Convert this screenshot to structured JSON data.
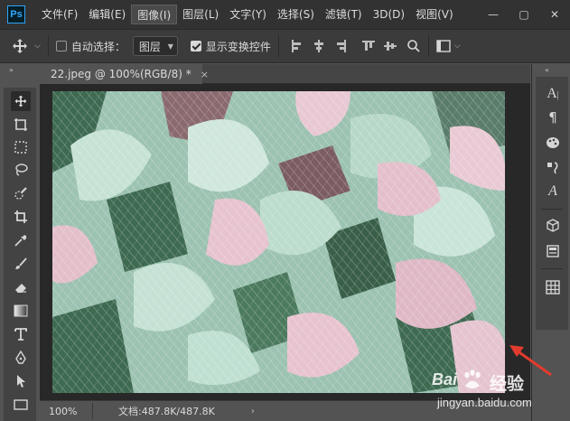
{
  "app": {
    "logo_text": "Ps"
  },
  "menu": {
    "items": [
      "文件(F)",
      "编辑(E)",
      "图像(I)",
      "图层(L)",
      "文字(Y)",
      "选择(S)",
      "滤镜(T)",
      "3D(D)",
      "视图(V)"
    ],
    "active_index": 2
  },
  "window_controls": {
    "minimize": "—",
    "restore": "▢",
    "close": "✕"
  },
  "options": {
    "auto_select_label": "自动选择：",
    "auto_select_checked": false,
    "target_value": "图层",
    "show_transform_label": "显示变换控件",
    "show_transform_checked": true
  },
  "document": {
    "tab_title": "22.jpeg @ 100%(RGB/8) *",
    "tab_close": "×",
    "image_description_colors": {
      "mint": "#b9d9cc",
      "pink": "#e7c3cf",
      "dark_green": "#3f6a52",
      "mauve": "#8a6a6f"
    }
  },
  "status": {
    "zoom": "100%",
    "doc_info": "文档:487.8K/487.8K",
    "arrow": "›"
  },
  "annotation": {
    "color": "#e23b2e"
  },
  "watermark": {
    "logo_text": "Bai",
    "brand_text": "经验",
    "url": "jingyan.baidu.com"
  },
  "colors": {
    "accent": "#31a8ff",
    "menubar_bg": "#323232",
    "panel_bg": "#535353"
  }
}
